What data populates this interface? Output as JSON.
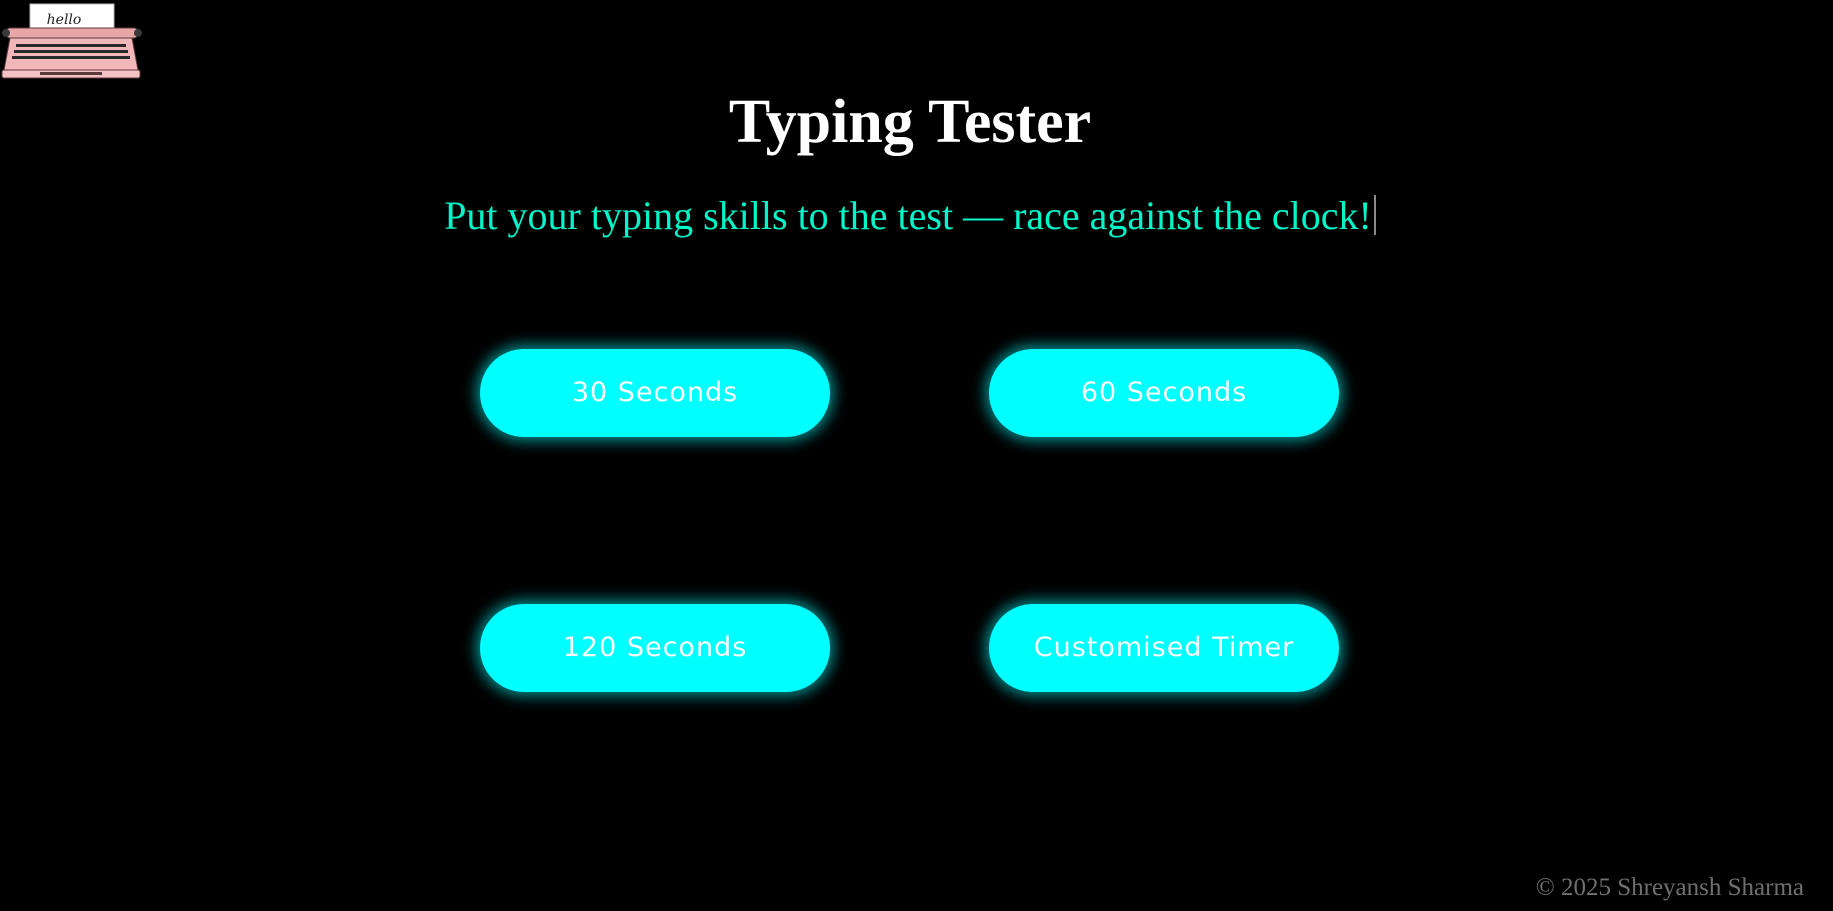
{
  "page": {
    "title": "Typing Tester",
    "tagline": "Put your typing skills to the test — race against the clock!"
  },
  "logo": {
    "icon": "typewriter-icon",
    "paper_text": "hello"
  },
  "timer_options": [
    {
      "label": "30 Seconds"
    },
    {
      "label": "60 Seconds"
    },
    {
      "label": "120 Seconds"
    },
    {
      "label": "Customised Timer"
    }
  ],
  "footer": {
    "copyright": "© 2025 Shreyansh Sharma"
  },
  "colors": {
    "background": "#000000",
    "title": "#ffffff",
    "tagline": "#00f5c8",
    "button_bg": "#00ffff",
    "button_text": "#ffffff",
    "footer_text": "#6f6f6f"
  }
}
